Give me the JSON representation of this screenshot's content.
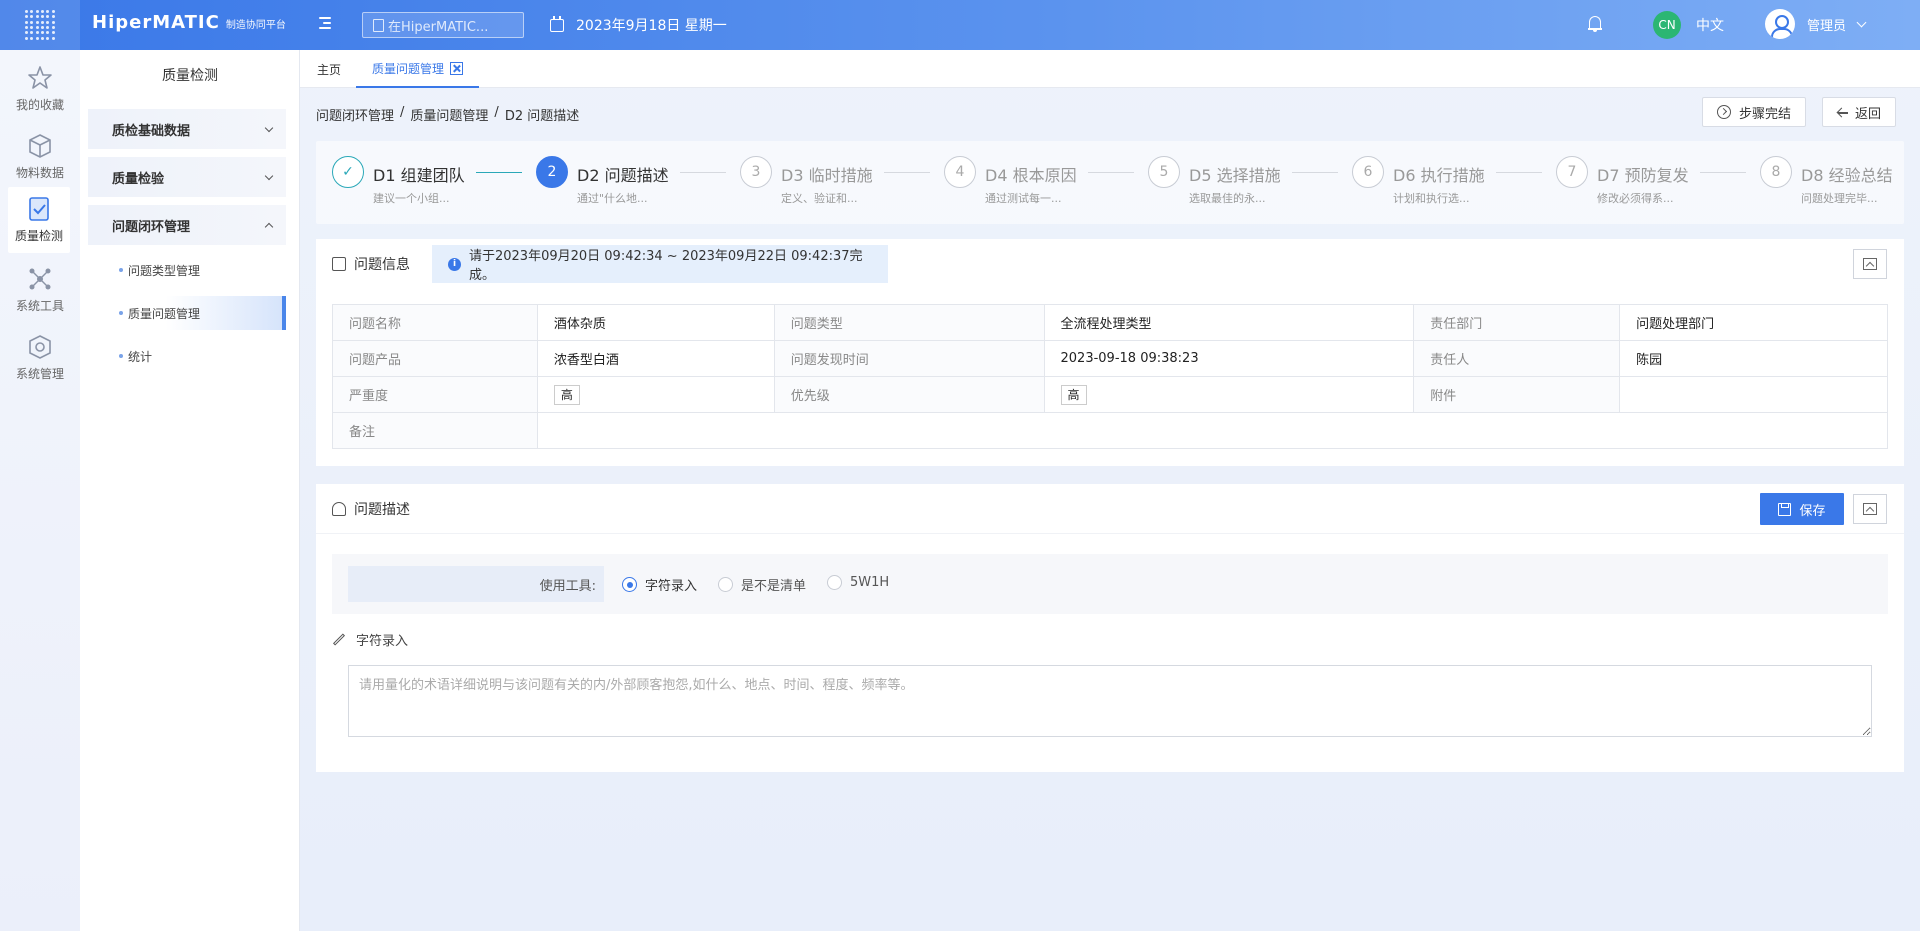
{
  "topbar": {
    "brand": "HiperMATIC",
    "brand_sub": "制造协同平台",
    "search_placeholder": "在HiperMATIC...",
    "date": "2023年9月18日 星期一",
    "lang_badge": "CN",
    "lang_label": "中文",
    "user_name": "管理员"
  },
  "rail": [
    {
      "label": "我的收藏",
      "icon": "star-icon"
    },
    {
      "label": "物料数据",
      "icon": "cube-icon"
    },
    {
      "label": "质量检测",
      "icon": "shield-check-icon"
    },
    {
      "label": "系统工具",
      "icon": "network-icon"
    },
    {
      "label": "系统管理",
      "icon": "gear-cube-icon"
    }
  ],
  "sidebar": {
    "title": "质量检测",
    "groups": [
      {
        "label": "质检基础数据"
      },
      {
        "label": "质量检验"
      },
      {
        "label": "问题闭环管理"
      }
    ],
    "sub_items": [
      {
        "label": "问题类型管理"
      },
      {
        "label": "质量问题管理"
      },
      {
        "label": "统计"
      }
    ]
  },
  "tabs": [
    {
      "label": "主页"
    },
    {
      "label": "质量问题管理"
    }
  ],
  "breadcrumb": [
    "问题闭环管理",
    "/",
    "质量问题管理",
    "/",
    "D2 问题描述"
  ],
  "actions": {
    "complete": "步骤完结",
    "back": "返回"
  },
  "steps": [
    {
      "num": "✓",
      "title": "D1 组建团队",
      "desc": "建议一个小组...",
      "state": "done"
    },
    {
      "num": "2",
      "title": "D2 问题描述",
      "desc": "通过\"什么地...",
      "state": "active"
    },
    {
      "num": "3",
      "title": "D3 临时措施",
      "desc": "定义、验证和...",
      "state": "todo"
    },
    {
      "num": "4",
      "title": "D4 根本原因",
      "desc": "通过测试每一...",
      "state": "todo"
    },
    {
      "num": "5",
      "title": "D5 选择措施",
      "desc": "选取最佳的永...",
      "state": "todo"
    },
    {
      "num": "6",
      "title": "D6 执行措施",
      "desc": "计划和执行选...",
      "state": "todo"
    },
    {
      "num": "7",
      "title": "D7 预防复发",
      "desc": "修改必须得系...",
      "state": "todo"
    },
    {
      "num": "8",
      "title": "D8 经验总结",
      "desc": "问题处理完毕...",
      "state": "todo"
    }
  ],
  "info_panel": {
    "title": "问题信息",
    "notice": "请于2023年09月20日 09:42:34 ~ 2023年09月22日 09:42:37完成。",
    "rows": [
      [
        {
          "label": "问题名称",
          "value": "酒体杂质"
        },
        {
          "label": "问题类型",
          "value": "全流程处理类型"
        },
        {
          "label": "责任部门",
          "value": "问题处理部门"
        }
      ],
      [
        {
          "label": "问题产品",
          "value": "浓香型白酒"
        },
        {
          "label": "问题发现时间",
          "value": "2023-09-18 09:38:23"
        },
        {
          "label": "责任人",
          "value": "陈园"
        }
      ],
      [
        {
          "label": "严重度",
          "value": "高"
        },
        {
          "label": "优先级",
          "value": "高"
        },
        {
          "label": "附件",
          "value": ""
        }
      ]
    ],
    "remark_label": "备注",
    "remark_value": ""
  },
  "desc_panel": {
    "title": "问题描述",
    "save": "保存",
    "tool_label": "使用工具:",
    "tools": [
      {
        "label": "字符录入",
        "selected": true
      },
      {
        "label": "是不是清单",
        "selected": false
      },
      {
        "label": "5W1H",
        "selected": false
      }
    ],
    "input_label": "字符录入",
    "placeholder": "请用量化的术语详细说明与该问题有关的内/外部顾客抱怨,如什么、地点、时间、程度、频率等。",
    "value": ""
  }
}
